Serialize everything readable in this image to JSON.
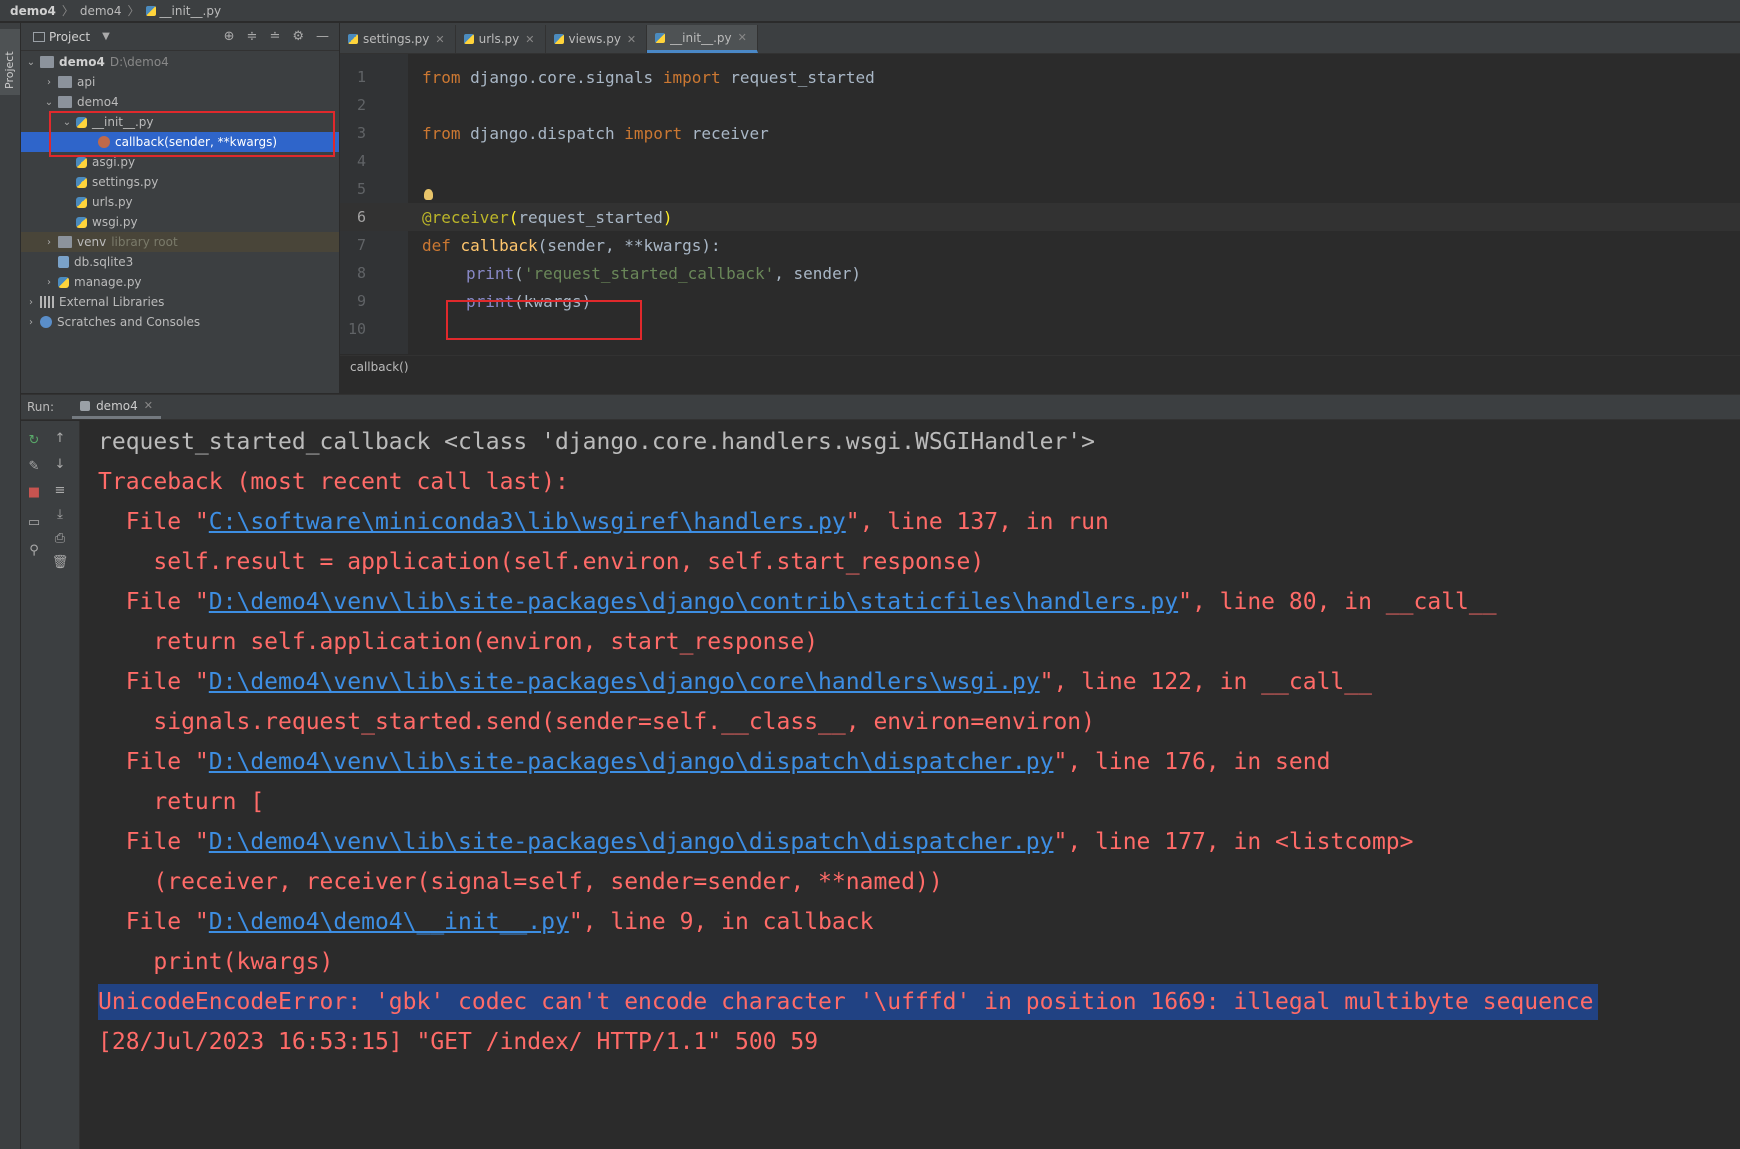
{
  "nav": {
    "root": "demo4",
    "folder": "demo4",
    "file": "__init__.py"
  },
  "left_strip": {
    "project_tab": "Project"
  },
  "project": {
    "title": "Project",
    "tree": [
      {
        "label": "demo4",
        "hint": "D:\\demo4"
      },
      {
        "label": "api"
      },
      {
        "label": "demo4"
      },
      {
        "label": "__init__.py"
      },
      {
        "label": "callback(sender, **kwargs)"
      },
      {
        "label": "asgi.py"
      },
      {
        "label": "settings.py"
      },
      {
        "label": "urls.py"
      },
      {
        "label": "wsgi.py"
      },
      {
        "label": "venv",
        "hint": "library root"
      },
      {
        "label": "db.sqlite3"
      },
      {
        "label": "manage.py"
      },
      {
        "label": "External Libraries"
      },
      {
        "label": "Scratches and Consoles"
      }
    ]
  },
  "editor": {
    "tabs": [
      {
        "label": "settings.py"
      },
      {
        "label": "urls.py"
      },
      {
        "label": "views.py"
      },
      {
        "label": "__init__.py"
      }
    ],
    "line_numbers": [
      "1",
      "2",
      "3",
      "4",
      "5",
      "6",
      "7",
      "8",
      "9",
      "10"
    ],
    "code": {
      "l1": {
        "kw": "from",
        "mod": " django.core.signals ",
        "kw2": "import",
        "name": " request_started"
      },
      "l3": {
        "kw": "from",
        "mod": " django.dispatch ",
        "kw2": "import",
        "name": " receiver"
      },
      "l6": {
        "dec": "@receiver",
        "open": "(",
        "arg": "request_started",
        "close": ")"
      },
      "l7": {
        "kw": "def ",
        "fn": "callback",
        "rest": "(sender, **kwargs):"
      },
      "l8": {
        "bi": "print",
        "open": "(",
        "str": "'request_started_callback'",
        "rest": ", sender)"
      },
      "l9": {
        "bi": "print",
        "rest": "(kwargs)"
      }
    },
    "breadcrumb": "callback()"
  },
  "run": {
    "label": "Run:",
    "tab": "demo4",
    "console": {
      "line1": "request_started_callback <class 'django.core.handlers.wsgi.WSGIHandler'>",
      "line2": "Traceback (most recent call last):",
      "f1_pre": "  File \"",
      "f1_path": "C:\\software\\miniconda3\\lib\\wsgiref\\handlers.py",
      "f1_post": "\", line 137, in run",
      "c1": "    self.result = application(self.environ, self.start_response)",
      "f2_pre": "  File \"",
      "f2_path": "D:\\demo4\\venv\\lib\\site-packages\\django\\contrib\\staticfiles\\handlers.py",
      "f2_post": "\", line 80, in __call__",
      "c2": "    return self.application(environ, start_response)",
      "f3_pre": "  File \"",
      "f3_path": "D:\\demo4\\venv\\lib\\site-packages\\django\\core\\handlers\\wsgi.py",
      "f3_post": "\", line 122, in __call__",
      "c3": "    signals.request_started.send(sender=self.__class__, environ=environ)",
      "f4_pre": "  File \"",
      "f4_path": "D:\\demo4\\venv\\lib\\site-packages\\django\\dispatch\\dispatcher.py",
      "f4_post": "\", line 176, in send",
      "c4": "    return [",
      "f5_pre": "  File \"",
      "f5_path": "D:\\demo4\\venv\\lib\\site-packages\\django\\dispatch\\dispatcher.py",
      "f5_post": "\", line 177, in <listcomp>",
      "c5": "    (receiver, receiver(signal=self, sender=sender, **named))",
      "f6_pre": "  File \"",
      "f6_path": "D:\\demo4\\demo4\\__init__.py",
      "f6_post": "\", line 9, in callback",
      "c6": "    print(kwargs)",
      "error": "UnicodeEncodeError: 'gbk' codec can't encode character '\\ufffd' in position 1669: illegal multibyte sequence",
      "log": "[28/Jul/2023 16:53:15] \"GET /index/ HTTP/1.1\" 500 59"
    }
  }
}
